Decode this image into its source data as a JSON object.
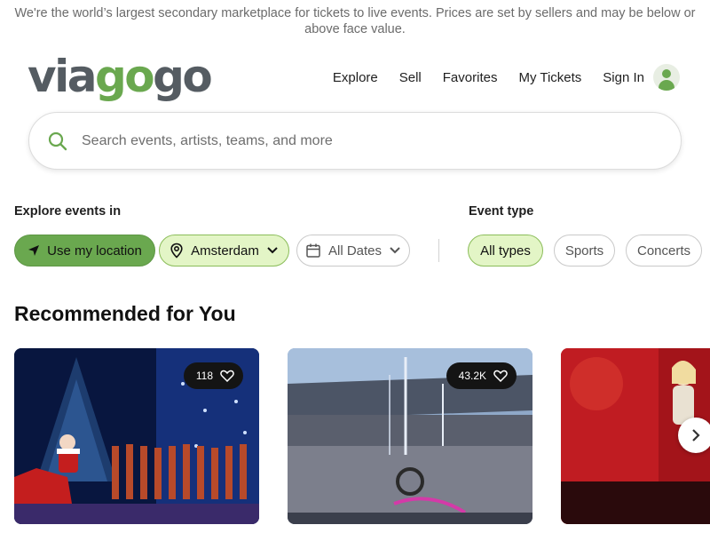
{
  "disclaimer": "We're the world’s largest secondary marketplace for tickets to live events. Prices are set by sellers and may be below or above face value.",
  "logo": {
    "part1": "via",
    "part2": "go",
    "part3": "go"
  },
  "nav": {
    "explore": "Explore",
    "sell": "Sell",
    "favorites": "Favorites",
    "my_tickets": "My Tickets",
    "sign_in": "Sign In"
  },
  "search": {
    "placeholder": "Search events, artists, teams, and more",
    "value": ""
  },
  "explore": {
    "label": "Explore events in",
    "use_location": "Use my location",
    "city": "Amsterdam",
    "dates": "All Dates"
  },
  "event_type": {
    "label": "Event type",
    "options": [
      "All types",
      "Sports",
      "Concerts"
    ],
    "selected": "All types"
  },
  "recommended": {
    "title": "Recommended for You",
    "cards": [
      {
        "favorites": "118"
      },
      {
        "favorites": "43.2K"
      },
      {
        "favorites": ""
      }
    ]
  },
  "colors": {
    "brand_green": "#6aa84f",
    "brand_gray": "#555c62",
    "chip_selected": "#e3f5c6"
  },
  "icons": [
    "search-icon",
    "navigation-arrow-icon",
    "map-pin-icon",
    "chevron-down-icon",
    "calendar-icon",
    "heart-icon",
    "chevron-right-icon",
    "user-icon"
  ]
}
